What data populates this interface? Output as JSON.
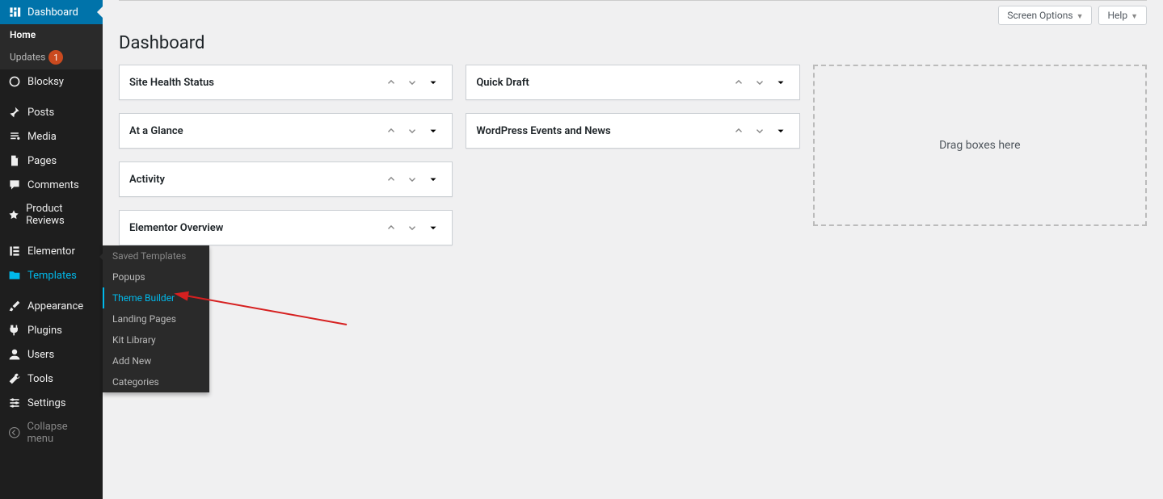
{
  "sidebar": {
    "items": [
      {
        "icon": "dashboard",
        "label": "Dashboard",
        "active": true
      },
      {
        "sub": [
          {
            "label": "Home",
            "current": true
          },
          {
            "label": "Updates",
            "badge": "1"
          }
        ]
      },
      {
        "icon": "blocksy",
        "label": "Blocksy"
      },
      {
        "sep": true
      },
      {
        "icon": "pin",
        "label": "Posts"
      },
      {
        "icon": "media",
        "label": "Media"
      },
      {
        "icon": "page",
        "label": "Pages"
      },
      {
        "icon": "comment",
        "label": "Comments"
      },
      {
        "icon": "star",
        "label": "Product Reviews"
      },
      {
        "sep": true
      },
      {
        "icon": "elementor",
        "label": "Elementor"
      },
      {
        "icon": "folder",
        "label": "Templates",
        "highlight": true
      },
      {
        "sep": true
      },
      {
        "icon": "brush",
        "label": "Appearance"
      },
      {
        "icon": "plug",
        "label": "Plugins"
      },
      {
        "icon": "user",
        "label": "Users"
      },
      {
        "icon": "wrench",
        "label": "Tools"
      },
      {
        "icon": "settings",
        "label": "Settings"
      },
      {
        "icon": "collapse",
        "label": "Collapse menu",
        "collapse": true
      }
    ]
  },
  "flyout": [
    {
      "label": "Saved Templates",
      "first": true
    },
    {
      "label": "Popups"
    },
    {
      "label": "Theme Builder",
      "highlight": true
    },
    {
      "label": "Landing Pages"
    },
    {
      "label": "Kit Library"
    },
    {
      "label": "Add New"
    },
    {
      "label": "Categories"
    }
  ],
  "topbar": {
    "screen_options": "Screen Options",
    "help": "Help"
  },
  "page_title": "Dashboard",
  "boxes": {
    "col1": [
      "Site Health Status",
      "At a Glance",
      "Activity",
      "Elementor Overview"
    ],
    "col2": [
      "Quick Draft",
      "WordPress Events and News"
    ]
  },
  "dropzone": "Drag boxes here"
}
